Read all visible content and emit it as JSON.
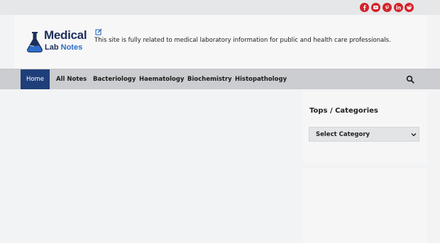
{
  "social": {
    "icons": [
      "facebook-icon",
      "youtube-icon",
      "pinterest-icon",
      "linkedin-icon",
      "reddit-icon"
    ],
    "color": "#d3222a"
  },
  "header": {
    "logo": {
      "line1": "Medical",
      "line2_a": "Lab",
      "line2_b": "Notes"
    },
    "tagline": "This site is fully related to medical laboratory information for public and health care professionals."
  },
  "nav": {
    "items": [
      {
        "label": "Home",
        "active": true
      },
      {
        "label": "All Notes"
      },
      {
        "label": "Bacteriology"
      },
      {
        "label": "Haematology"
      },
      {
        "label": "Biochemistry"
      },
      {
        "label": "Histopathology"
      }
    ],
    "search_icon": "search-icon",
    "active_color": "#1f3f7a"
  },
  "sidebar": {
    "widget_title": "Tops / Categories",
    "select_value": "Select Category"
  }
}
